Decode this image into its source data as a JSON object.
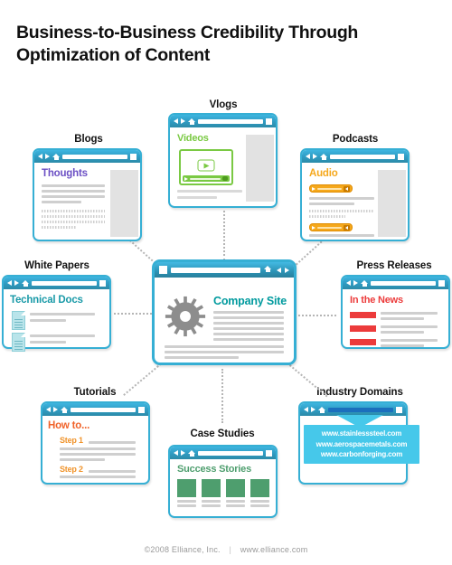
{
  "page": {
    "title": "Business-to-Business Credibility Through Optimization of Content",
    "title_line1": "Business-to-Business Credibility Through",
    "title_line2": "Optimization of Content"
  },
  "footer": {
    "copyright": "©2008 Elliance, Inc.",
    "separator": "|",
    "url": "www.elliance.com"
  },
  "colors": {
    "window_border": "#36afd4",
    "titlebar_blue": "#3eb5e0",
    "teal_accent": "#009a9e",
    "blog_purple": "#6b4fc4",
    "video_green": "#7ac943",
    "audio_orange": "#f5a81c",
    "news_red": "#ec3b3b",
    "tutorial_orange": "#f0632a",
    "case_green": "#4e9e6e",
    "callout_cyan": "#46c8ea",
    "connector_gray": "#b5b5b5"
  },
  "center": {
    "label": "Company Site",
    "nav_blocks": 8,
    "icon": "gear-icon"
  },
  "nodes": [
    {
      "key": "blogs",
      "label": "Blogs",
      "heading": "Thoughts",
      "heading_color": "#6b4fc4"
    },
    {
      "key": "vlogs",
      "label": "Vlogs",
      "heading": "Videos",
      "heading_color": "#7ac943"
    },
    {
      "key": "podcasts",
      "label": "Podcasts",
      "heading": "Audio",
      "heading_color": "#f5a81c"
    },
    {
      "key": "white-papers",
      "label": "White Papers",
      "heading": "Technical Docs",
      "heading_color": "#1a9aa8"
    },
    {
      "key": "press-releases",
      "label": "Press Releases",
      "heading": "In the News",
      "heading_color": "#ec3b3b"
    },
    {
      "key": "tutorials",
      "label": "Tutorials",
      "heading": "How to...",
      "heading_color": "#f0632a"
    },
    {
      "key": "case-studies",
      "label": "Case Studies",
      "heading": "Success Stories",
      "heading_color": "#4e9e6e"
    },
    {
      "key": "industry-domains",
      "label": "Industry Domains",
      "heading": "",
      "heading_color": "#46c8ea"
    }
  ],
  "tutorials": {
    "step1": "Step 1",
    "step2": "Step 2"
  },
  "industry_domains": {
    "urls": [
      "www.stainlesssteel.com",
      "www.aerospacemetals.com",
      "www.carbonforging.com"
    ]
  }
}
